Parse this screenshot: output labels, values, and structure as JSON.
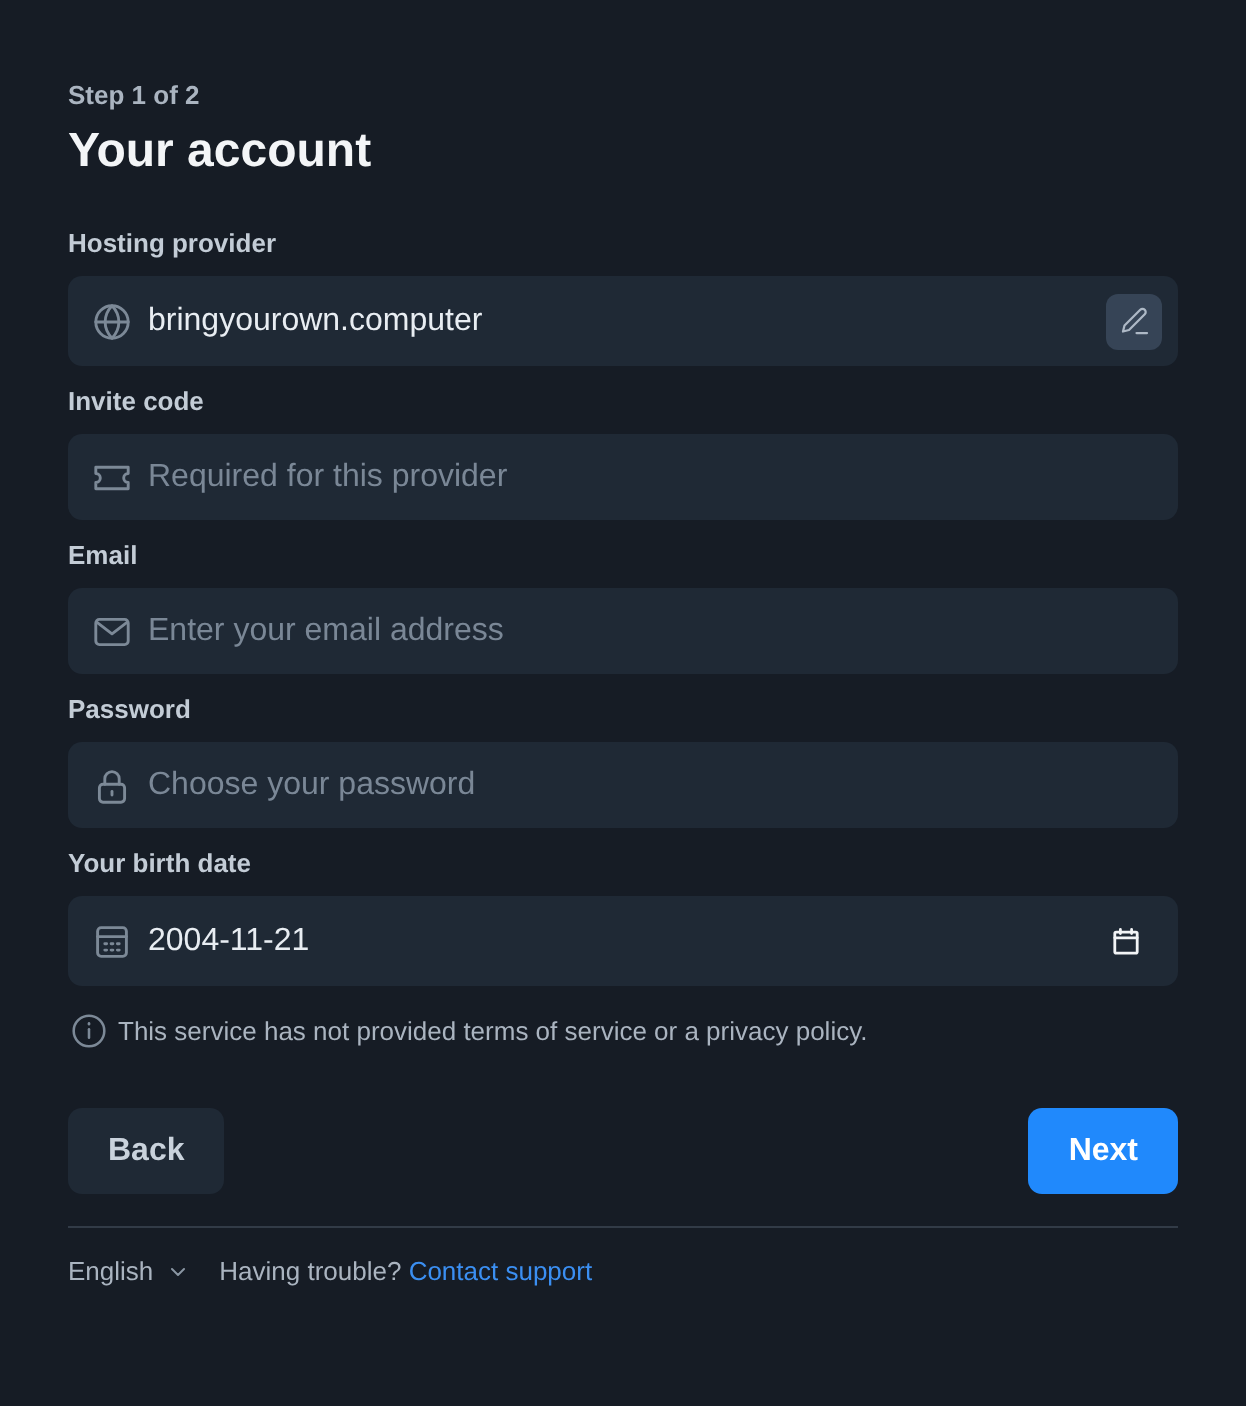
{
  "step": "Step 1 of 2",
  "title": "Your account",
  "fields": [
    {
      "kind": "provider",
      "label": "Hosting provider",
      "value": "bringyourown.computer"
    },
    {
      "kind": "invite",
      "label": "Invite code",
      "placeholder": "Required for this provider"
    },
    {
      "kind": "email",
      "label": "Email",
      "placeholder": "Enter your email address"
    },
    {
      "kind": "password",
      "label": "Password",
      "placeholder": "Choose your password"
    },
    {
      "kind": "date",
      "label": "Your birth date",
      "value": "2004-11-21"
    }
  ],
  "notice": "This service has not provided terms of service or a privacy policy.",
  "buttons": [
    {
      "kind": "secondary",
      "label": "Back"
    },
    {
      "kind": "primary",
      "label": "Next"
    }
  ],
  "footer": {
    "language": "English",
    "help_text": "Having trouble?",
    "link": "Contact support"
  }
}
